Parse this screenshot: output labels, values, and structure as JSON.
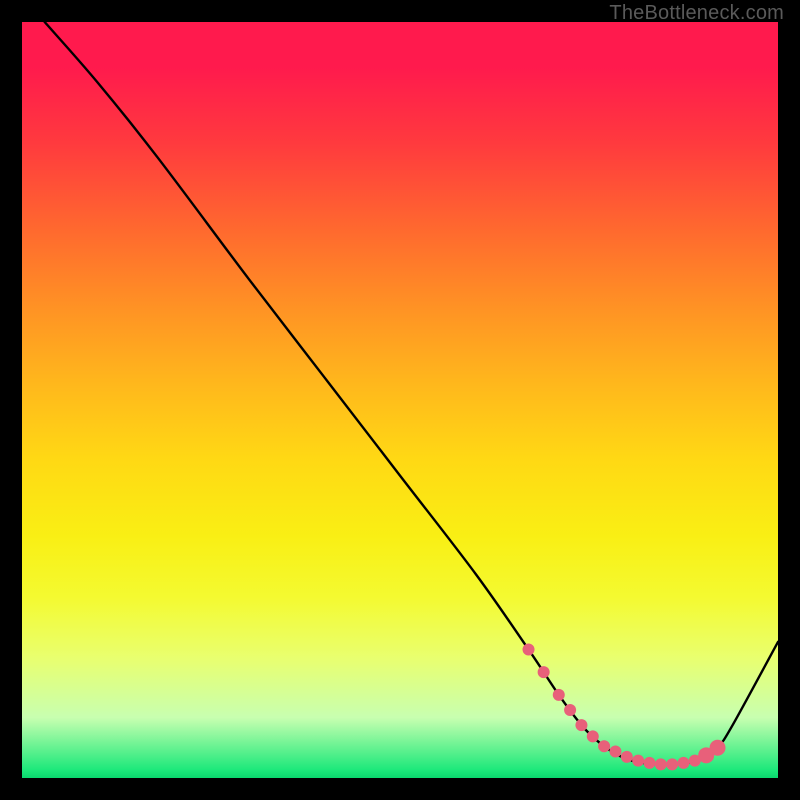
{
  "watermark": "TheBottleneck.com",
  "chart_data": {
    "type": "line",
    "title": "",
    "xlabel": "",
    "ylabel": "",
    "xlim": [
      0,
      100
    ],
    "ylim": [
      0,
      100
    ],
    "series": [
      {
        "name": "curve",
        "x": [
          3,
          10,
          18,
          30,
          40,
          50,
          60,
          67,
          71,
          74,
          76,
          78,
          80,
          82,
          84,
          86,
          88,
          90,
          92,
          94,
          100
        ],
        "y": [
          100,
          92,
          82,
          66,
          53,
          40,
          27,
          17,
          11,
          7,
          5,
          3.5,
          2.5,
          2,
          1.8,
          1.8,
          2,
          2.5,
          4,
          7,
          18
        ]
      }
    ],
    "markers": {
      "name": "highlight",
      "x": [
        67,
        69,
        71,
        72.5,
        74,
        75.5,
        77,
        78.5,
        80,
        81.5,
        83,
        84.5,
        86,
        87.5,
        89,
        90.5,
        92
      ],
      "y": [
        17,
        14,
        11,
        9,
        7,
        5.5,
        4.2,
        3.5,
        2.8,
        2.3,
        2,
        1.8,
        1.8,
        2,
        2.3,
        3,
        4
      ],
      "r": 6
    },
    "big_markers": {
      "x": [
        90.5,
        92
      ],
      "y": [
        3,
        4
      ],
      "r": 8
    }
  }
}
